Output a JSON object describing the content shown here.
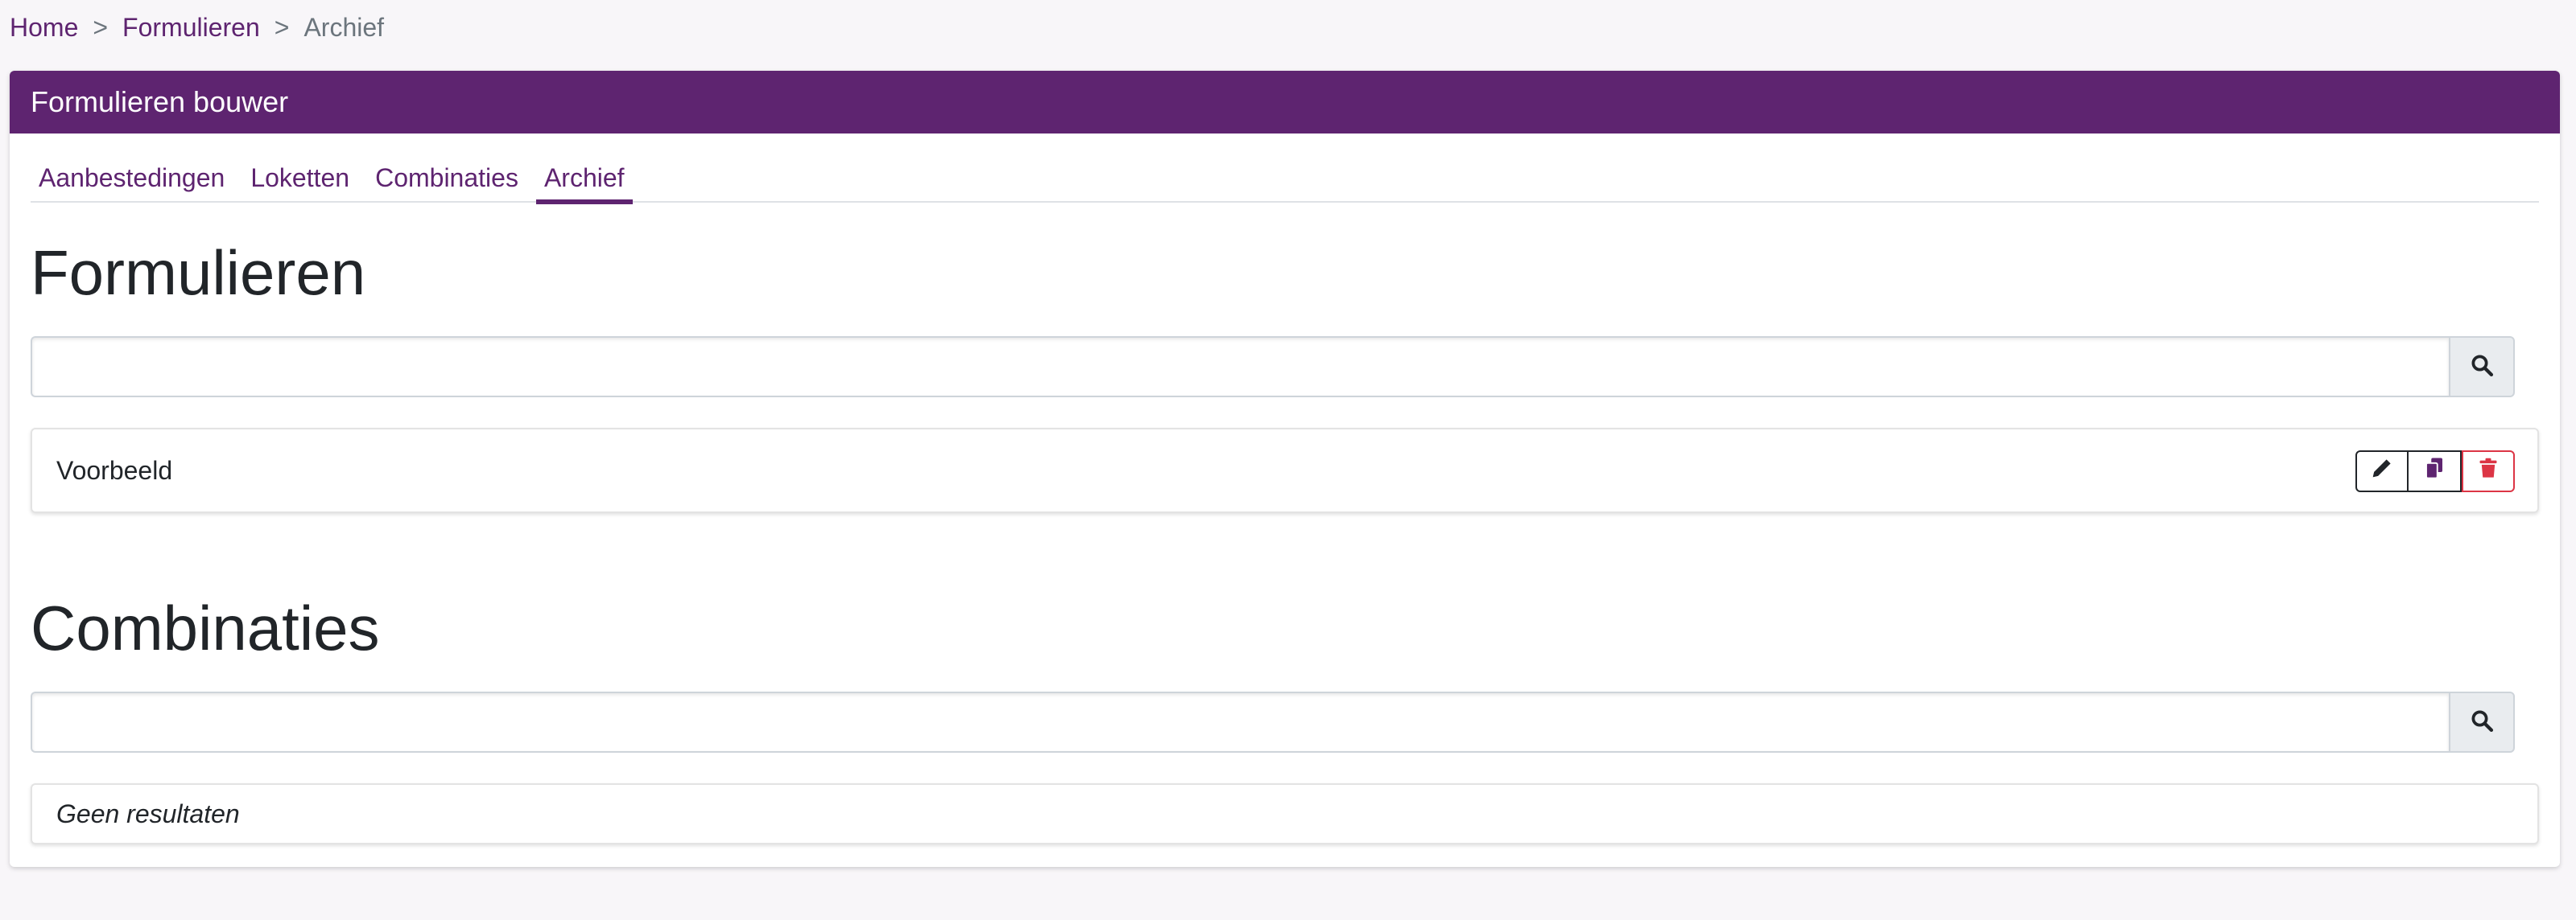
{
  "breadcrumb": {
    "home": "Home",
    "separator": ">",
    "parent": "Formulieren",
    "current": "Archief"
  },
  "card": {
    "title": "Formulieren bouwer"
  },
  "tabs": [
    {
      "label": "Aanbestedingen",
      "active": false
    },
    {
      "label": "Loketten",
      "active": false
    },
    {
      "label": "Combinaties",
      "active": false
    },
    {
      "label": "Archief",
      "active": true
    }
  ],
  "formulieren": {
    "title": "Formulieren",
    "search_value": "",
    "items": [
      {
        "name": "Voorbeeld"
      }
    ]
  },
  "combinaties": {
    "title": "Combinaties",
    "search_value": "",
    "empty_text": "Geen resultaten"
  },
  "colors": {
    "brand": "#5e2470",
    "danger": "#dc3545",
    "copy_icon": "#5e2470"
  },
  "icons": {
    "search": "search-icon",
    "edit": "pencil-icon",
    "copy": "copy-icon",
    "delete": "trash-icon"
  }
}
